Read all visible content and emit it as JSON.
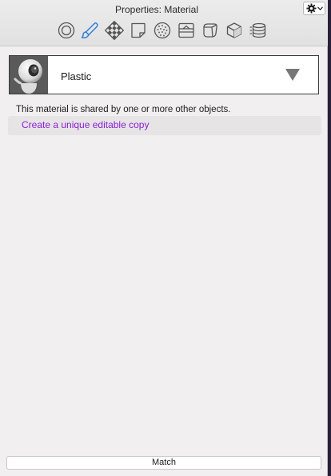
{
  "window": {
    "title": "Properties: Material"
  },
  "toolbar": {
    "tabs": [
      {
        "icon": "entity-info-icon",
        "active": false
      },
      {
        "icon": "material-paintbrush-icon",
        "active": true
      },
      {
        "icon": "texture-checker-icon",
        "active": false
      },
      {
        "icon": "note-page-icon",
        "active": false
      },
      {
        "icon": "bump-sphere-icon",
        "active": false
      },
      {
        "icon": "scene-layer-icon",
        "active": false
      },
      {
        "icon": "object-faces-icon",
        "active": false
      },
      {
        "icon": "cube-shade-icon",
        "active": false
      },
      {
        "icon": "layers-stack-icon",
        "active": false
      }
    ],
    "accent_color": "#2f7fd8"
  },
  "material": {
    "name": "Plastic"
  },
  "notice": {
    "text": "This material is shared by one or more other objects.",
    "link": "Create a unique editable copy",
    "link_color": "#8a1fd6"
  },
  "footer": {
    "match_label": "Match"
  }
}
